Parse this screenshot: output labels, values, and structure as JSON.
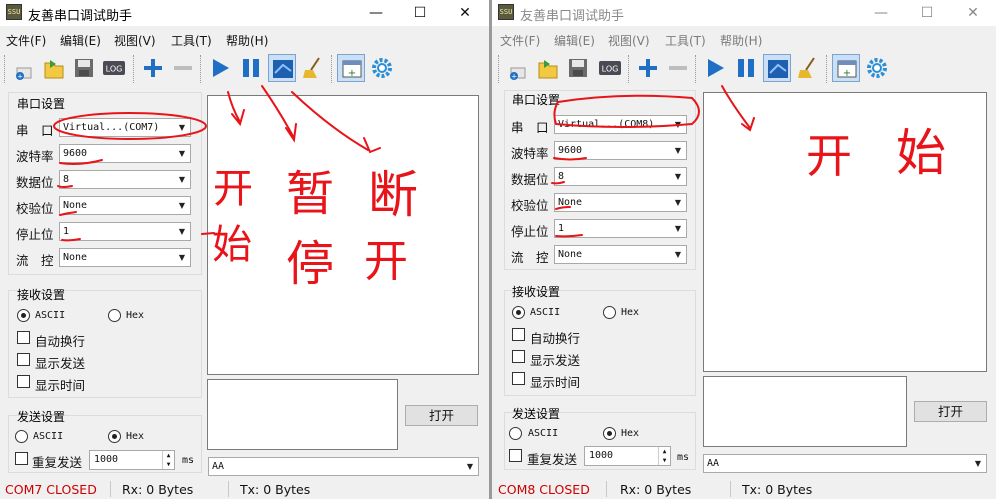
{
  "windows": [
    {
      "title": "友善串口调试助手",
      "app_icon_text": "SSU",
      "menu": [
        "文件(F)",
        "编辑(E)",
        "视图(V)",
        "工具(T)",
        "帮助(H)"
      ],
      "serial_settings": {
        "group_label": "串口设置",
        "port_label": "串　口",
        "port_value": "Virtual...(COM7)",
        "baud_label": "波特率",
        "baud_value": "9600",
        "databits_label": "数据位",
        "databits_value": "8",
        "parity_label": "校验位",
        "parity_value": "None",
        "stopbits_label": "停止位",
        "stopbits_value": "1",
        "flow_label": "流　控",
        "flow_value": "None"
      },
      "receive_settings": {
        "group_label": "接收设置",
        "ascii_label": "ASCII",
        "hex_label": "Hex",
        "mode_selected": "ASCII",
        "auto_newline_label": "自动换行",
        "show_send_label": "显示发送",
        "show_time_label": "显示时间"
      },
      "send_settings": {
        "group_label": "发送设置",
        "ascii_label": "ASCII",
        "hex_label": "Hex",
        "mode_selected": "Hex",
        "repeat_label": "重复发送",
        "interval_value": "1000",
        "interval_unit": "ms"
      },
      "open_button_label": "打开",
      "send_combo_value": "AA",
      "status": {
        "port_state": "COM7 CLOSED",
        "rx": "Rx: 0 Bytes",
        "tx": "Tx: 0 Bytes"
      },
      "annotations": [
        "开",
        "始",
        "暂",
        "停",
        "断",
        "开"
      ]
    },
    {
      "title": "友善串口调试助手",
      "app_icon_text": "SSU",
      "menu": [
        "文件(F)",
        "编辑(E)",
        "视图(V)",
        "工具(T)",
        "帮助(H)"
      ],
      "serial_settings": {
        "group_label": "串口设置",
        "port_label": "串　口",
        "port_value": "Virtual...(COM8)",
        "baud_label": "波特率",
        "baud_value": "9600",
        "databits_label": "数据位",
        "databits_value": "8",
        "parity_label": "校验位",
        "parity_value": "None",
        "stopbits_label": "停止位",
        "stopbits_value": "1",
        "flow_label": "流　控",
        "flow_value": "None"
      },
      "receive_settings": {
        "group_label": "接收设置",
        "ascii_label": "ASCII",
        "hex_label": "Hex",
        "mode_selected": "ASCII",
        "auto_newline_label": "自动换行",
        "show_send_label": "显示发送",
        "show_time_label": "显示时间"
      },
      "send_settings": {
        "group_label": "发送设置",
        "ascii_label": "ASCII",
        "hex_label": "Hex",
        "mode_selected": "Hex",
        "repeat_label": "重复发送",
        "interval_value": "1000",
        "interval_unit": "ms"
      },
      "open_button_label": "打开",
      "send_combo_value": "AA",
      "status": {
        "port_state": "COM8 CLOSED",
        "rx": "Rx: 0 Bytes",
        "tx": "Tx: 0 Bytes"
      },
      "annotations": [
        "开",
        "始"
      ]
    }
  ],
  "toolbar_icons": [
    "new-icon",
    "open-folder-icon",
    "save-icon",
    "log-icon",
    "add-icon",
    "remove-icon",
    "play-icon",
    "pause-icon",
    "disconnect-icon",
    "clear-broom-icon",
    "layout-icon",
    "settings-gear-icon"
  ],
  "colors": {
    "annotation_ink": "#e8141a",
    "status_closed": "#cc0000",
    "toolbar_blue": "#1f6fc5",
    "selected_button_bg": "#c9e0f7"
  }
}
